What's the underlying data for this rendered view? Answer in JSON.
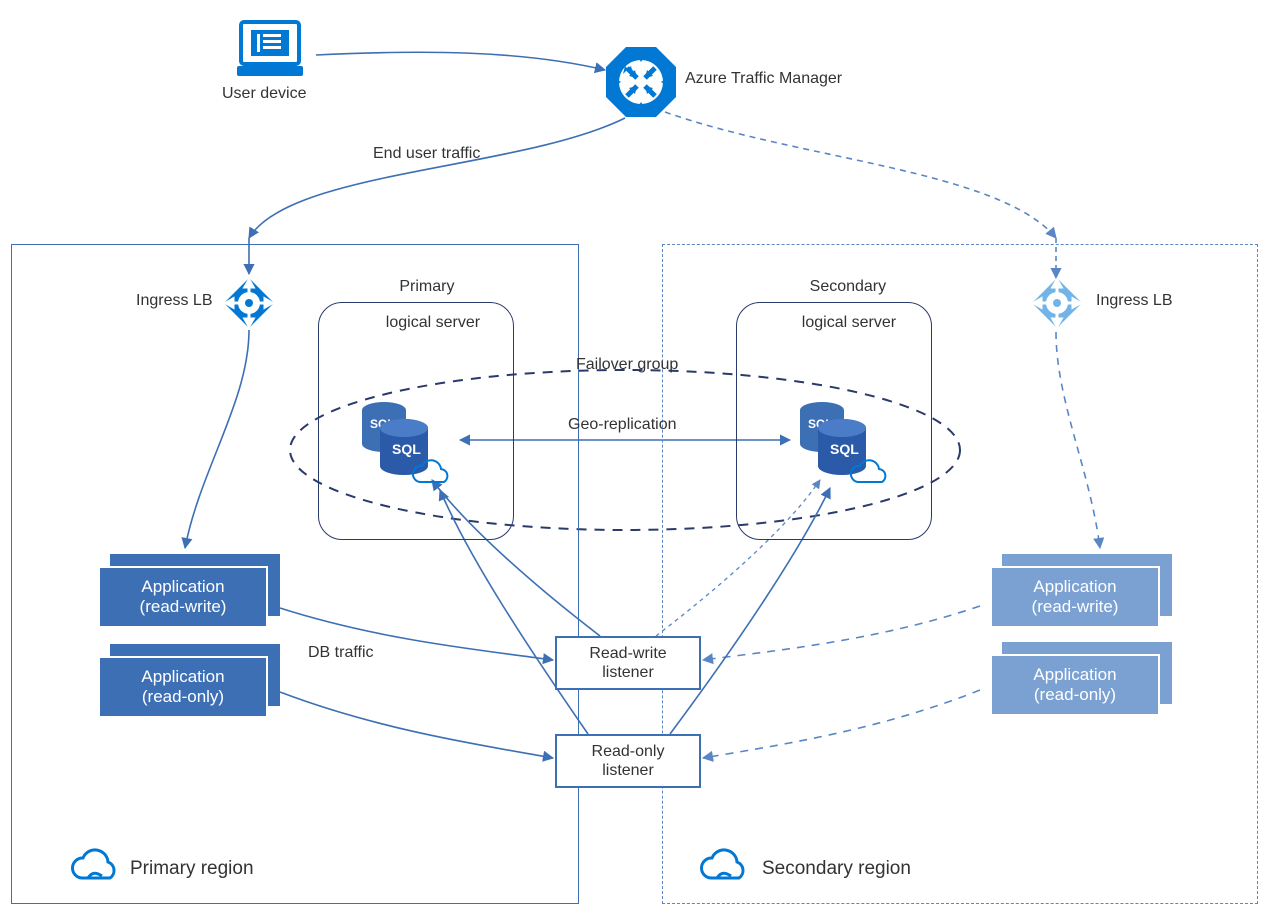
{
  "top": {
    "user_device_label": "User device",
    "traffic_manager_label": "Azure Traffic Manager",
    "end_user_traffic_label": "End user traffic"
  },
  "primary": {
    "region_label": "Primary region",
    "ingress_label": "Ingress LB",
    "server_label_line1": "Primary",
    "server_label_line2": "logical server",
    "app_rw_line1": "Application",
    "app_rw_line2": "(read-write)",
    "app_ro_line1": "Application",
    "app_ro_line2": "(read-only)",
    "db_traffic_label": "DB traffic"
  },
  "secondary": {
    "region_label": "Secondary region",
    "ingress_label": "Ingress LB",
    "server_label_line1": "Secondary",
    "server_label_line2": "logical server",
    "app_rw_line1": "Application",
    "app_rw_line2": "(read-write)",
    "app_ro_line1": "Application",
    "app_ro_line2": "(read-only)"
  },
  "failover": {
    "group_label": "Failover group",
    "geo_replication_label": "Geo-replication"
  },
  "listeners": {
    "rw_line1": "Read-write",
    "rw_line2": "listener",
    "ro_line1": "Read-only",
    "ro_line2": "listener"
  },
  "colors": {
    "azure_blue": "#0078d4",
    "line_blue": "#3d6fb4",
    "dark_navy": "#2a3a6a",
    "faded_blue": "#7ba0d2"
  }
}
